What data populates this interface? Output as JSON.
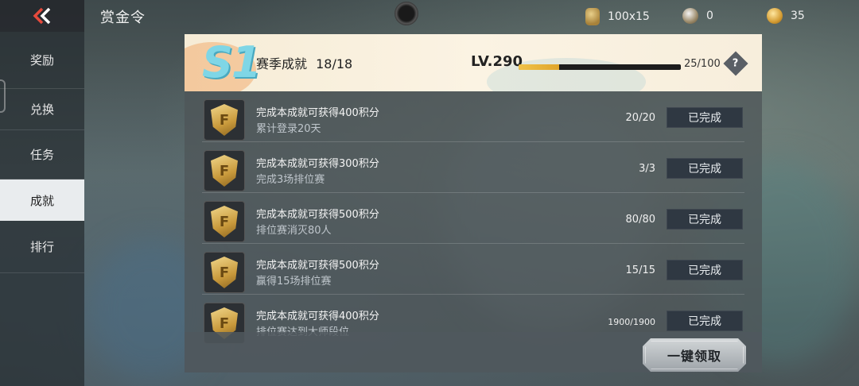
{
  "header": {
    "title": "赏金令",
    "currencies": [
      {
        "icon": "ticket-icon",
        "value": "100x15"
      },
      {
        "icon": "token-icon",
        "value": "0"
      },
      {
        "icon": "coin-icon",
        "value": "35"
      }
    ]
  },
  "sidebar": {
    "items": [
      {
        "label": "奖励",
        "active": false
      },
      {
        "label": "兑换",
        "active": false
      },
      {
        "label": "任务",
        "active": false
      },
      {
        "label": "成就",
        "active": true
      },
      {
        "label": "排行",
        "active": false
      }
    ]
  },
  "season": {
    "badge": "S1",
    "title": "赛季成就",
    "count": "18/18",
    "level": "LV.290",
    "xp_text": "25/100",
    "xp_fraction": 0.25,
    "help_label": "?"
  },
  "achievements": [
    {
      "title": "完成本成就可获得400积分",
      "desc": "累计登录20天",
      "progress": "20/20",
      "status": "已完成"
    },
    {
      "title": "完成本成就可获得300积分",
      "desc": "完成3场排位赛",
      "progress": "3/3",
      "status": "已完成"
    },
    {
      "title": "完成本成就可获得500积分",
      "desc": "排位赛消灭80人",
      "progress": "80/80",
      "status": "已完成"
    },
    {
      "title": "完成本成就可获得500积分",
      "desc": "赢得15场排位赛",
      "progress": "15/15",
      "status": "已完成"
    },
    {
      "title": "完成本成就可获得400积分",
      "desc": "排位赛达到大师段位",
      "progress": "1900/1900",
      "status": "已完成"
    }
  ],
  "footer": {
    "claim_all_label": "一键领取"
  }
}
